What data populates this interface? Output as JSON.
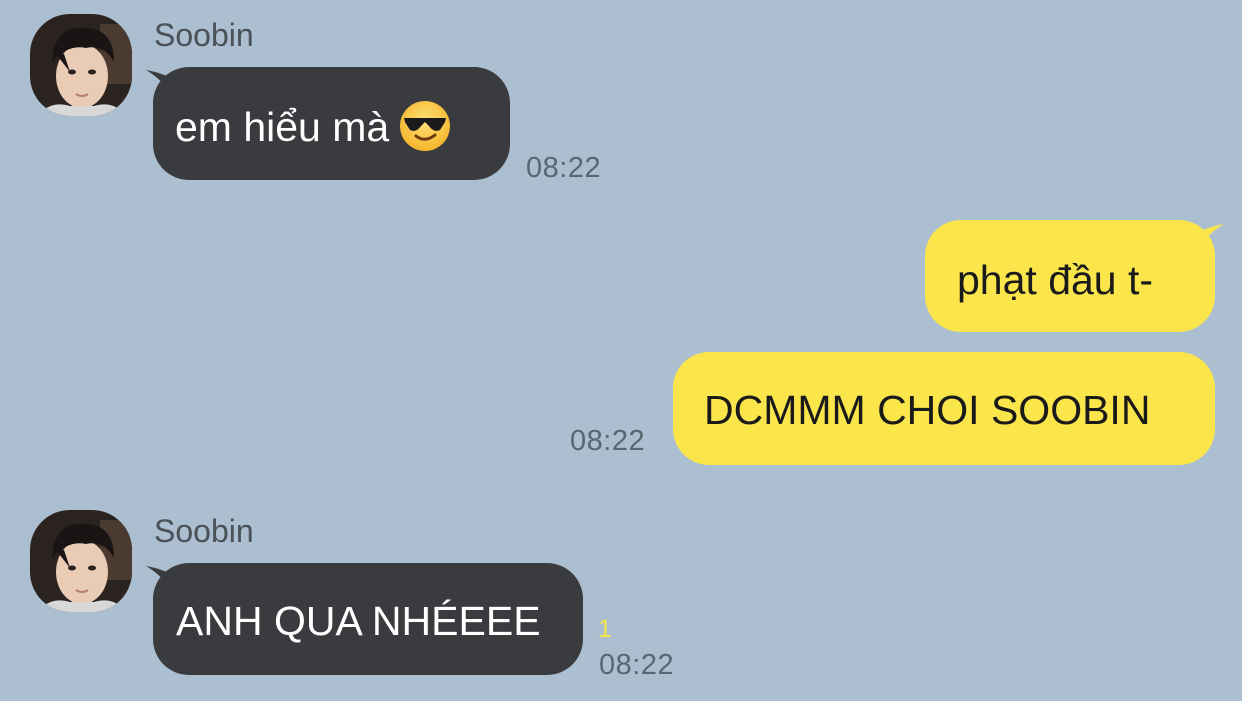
{
  "colors": {
    "background": "#ABBFD0",
    "incoming_bubble": "#3A3B3F",
    "outgoing_bubble": "#FAE54B",
    "unread_count": "#F9E54A",
    "timestamp": "#5A6671"
  },
  "messages": [
    {
      "sender": "Soobin",
      "avatar_icon": "profile-photo",
      "text": "em hiểu mà",
      "emoji": "sunglasses-emoji",
      "time": "08:22"
    },
    {
      "sender": "me",
      "text": "phạt đầu t-"
    },
    {
      "sender": "me",
      "text": "DCMMM CHOI SOOBIN",
      "time": "08:22"
    },
    {
      "sender": "Soobin",
      "avatar_icon": "profile-photo",
      "text": "ANH QUA NHÉEEE",
      "unread": "1",
      "time": "08:22"
    }
  ]
}
